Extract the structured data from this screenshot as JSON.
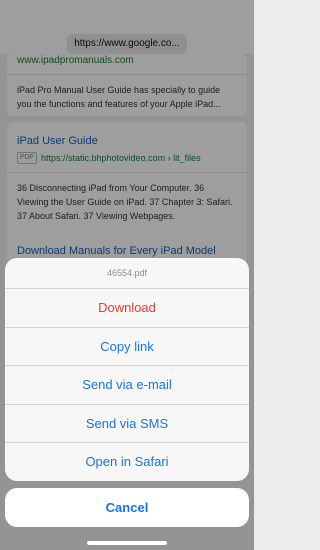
{
  "browser": {
    "url_display": "https://www.google.co..."
  },
  "results": [
    {
      "link_top": "www.ipadpromanuals.com",
      "snippet": "iPad Pro Manual User Guide has specially to guide you the functions and features of your Apple iPad..."
    },
    {
      "title": "iPad User Guide",
      "file_tag": "PDF",
      "url": "https://static.bhphotovideo.com › lit_files",
      "snippet": "36 Disconnecting iPad from Your Computer. 36 Viewing the User Guide on iPad. 37 Chapter 3: Safari. 37 About Safari. 37 Viewing Webpages."
    },
    {
      "title": "Download Manuals for Every iPad Model"
    }
  ],
  "action_sheet": {
    "title": "46554.pdf",
    "items": [
      {
        "label": "Download",
        "style": "destructive"
      },
      {
        "label": "Copy link",
        "style": "default"
      },
      {
        "label": "Send via e-mail",
        "style": "default"
      },
      {
        "label": "Send via SMS",
        "style": "default"
      },
      {
        "label": "Open in Safari",
        "style": "default"
      }
    ],
    "cancel_label": "Cancel"
  },
  "colors": {
    "action_blue": "#1a73e8",
    "destructive_red": "#e33b2e",
    "link_blue": "#1a5fb4",
    "url_green": "#1a7a3a"
  }
}
